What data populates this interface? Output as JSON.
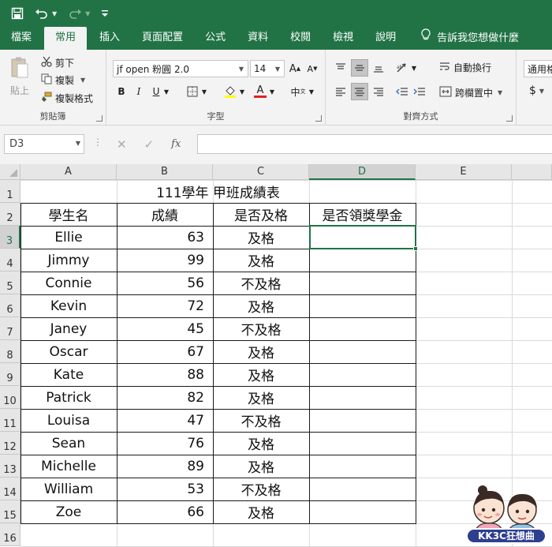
{
  "qat": {
    "icons": [
      "save-icon",
      "undo-icon",
      "redo-icon",
      "customize-qat-icon"
    ]
  },
  "tabs": {
    "file": "檔案",
    "home": "常用",
    "insert": "插入",
    "page_layout": "頁面配置",
    "formulas": "公式",
    "data": "資料",
    "review": "校閱",
    "view": "檢視",
    "help": "說明",
    "tell_me": "告訴我您想做什麼"
  },
  "ribbon": {
    "clipboard": {
      "label": "剪貼簿",
      "paste": "貼上",
      "cut": "剪下",
      "copy": "複製",
      "format_painter": "複製格式"
    },
    "font": {
      "label": "字型",
      "font_name": "jf open 粉圓 2.0",
      "font_size": "14",
      "bold": "B",
      "italic": "I",
      "underline": "U",
      "font_color": "#e02020"
    },
    "alignment": {
      "label": "對齊方式",
      "wrap_text": "自動換行",
      "merge_center": "跨欄置中"
    },
    "number": {
      "format": "通用格",
      "currency": "$"
    }
  },
  "formula_bar": {
    "name_box": "D3",
    "formula": ""
  },
  "sheet": {
    "columns": [
      "A",
      "B",
      "C",
      "D",
      "E"
    ],
    "rows": [
      "1",
      "2",
      "3",
      "4",
      "5",
      "6",
      "7",
      "8",
      "9",
      "10",
      "11",
      "12",
      "13",
      "14",
      "15",
      "16"
    ],
    "title": "111學年 甲班成績表",
    "headers": [
      "學生名",
      "成績",
      "是否及格",
      "是否領獎學金"
    ],
    "records": [
      {
        "name": "Ellie",
        "score": "63",
        "pass": "及格",
        "scholarship": ""
      },
      {
        "name": "Jimmy",
        "score": "99",
        "pass": "及格",
        "scholarship": ""
      },
      {
        "name": "Connie",
        "score": "56",
        "pass": "不及格",
        "scholarship": ""
      },
      {
        "name": "Kevin",
        "score": "72",
        "pass": "及格",
        "scholarship": ""
      },
      {
        "name": "Janey",
        "score": "45",
        "pass": "不及格",
        "scholarship": ""
      },
      {
        "name": "Oscar",
        "score": "67",
        "pass": "及格",
        "scholarship": ""
      },
      {
        "name": "Kate",
        "score": "88",
        "pass": "及格",
        "scholarship": ""
      },
      {
        "name": "Patrick",
        "score": "82",
        "pass": "及格",
        "scholarship": ""
      },
      {
        "name": "Louisa",
        "score": "47",
        "pass": "不及格",
        "scholarship": ""
      },
      {
        "name": "Sean",
        "score": "76",
        "pass": "及格",
        "scholarship": ""
      },
      {
        "name": "Michelle",
        "score": "89",
        "pass": "及格",
        "scholarship": ""
      },
      {
        "name": "William",
        "score": "53",
        "pass": "不及格",
        "scholarship": ""
      },
      {
        "name": "Zoe",
        "score": "66",
        "pass": "及格",
        "scholarship": ""
      }
    ]
  },
  "watermark": {
    "text": "KK3C狂想曲"
  },
  "colors": {
    "brand": "#217346",
    "ribbon_bg": "#f3f3f3"
  }
}
